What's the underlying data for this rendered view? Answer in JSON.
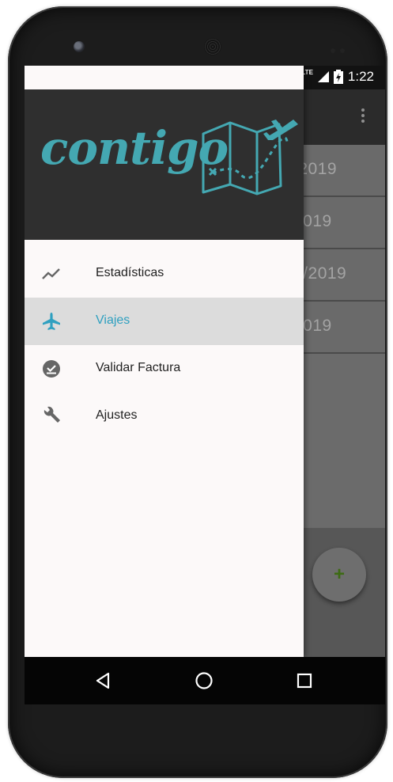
{
  "status_bar": {
    "network": "LTE",
    "time": "1:22"
  },
  "drawer": {
    "brand": "contigo",
    "menu": [
      {
        "label": "Estadísticas",
        "icon": "trending-up-icon",
        "active": false
      },
      {
        "label": "Viajes",
        "icon": "airplane-icon",
        "active": true
      },
      {
        "label": "Validar Factura",
        "icon": "check-circle-icon",
        "active": false
      },
      {
        "label": "Ajustes",
        "icon": "wrench-icon",
        "active": false
      }
    ]
  },
  "trips": [
    {
      "date": "/2019"
    },
    {
      "date": "2019"
    },
    {
      "date": "2/2019"
    },
    {
      "date": "2019"
    }
  ],
  "fab": {
    "label": "+"
  },
  "colors": {
    "brand": "#44a8b2",
    "active_text": "#2fa0c0",
    "active_bg": "#dcdcdc"
  }
}
